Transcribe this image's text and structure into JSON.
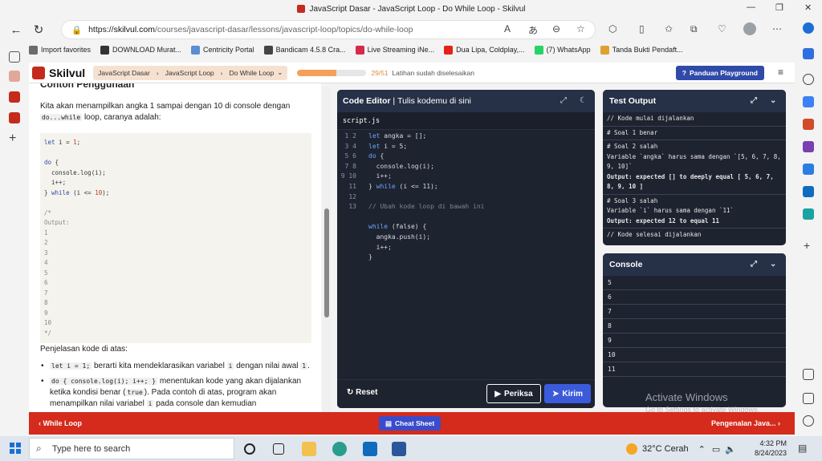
{
  "window": {
    "title": "JavaScript Dasar - JavaScript Loop - Do While Loop - Skilvul"
  },
  "browser": {
    "url_prefix": "https://",
    "url_host": "skilvul.com",
    "url_path": "/courses/javascript-dasar/lessons/javascript-loop/topics/do-while-loop",
    "bookmarks": [
      {
        "label": "Import favorites",
        "color": "#6b6b6b"
      },
      {
        "label": "DOWNLOAD Murat...",
        "color": "#333333"
      },
      {
        "label": "Centricity Portal",
        "color": "#5b8dd6"
      },
      {
        "label": "Bandicam 4.5.8 Cra...",
        "color": "#444444"
      },
      {
        "label": "Live Streaming iNe...",
        "color": "#d62a4a"
      },
      {
        "label": "Dua Lipa, Coldplay,...",
        "color": "#e62117"
      },
      {
        "label": "(7) WhatsApp",
        "color": "#25d366"
      },
      {
        "label": "Tanda Bukti Pendaft...",
        "color": "#e0a030"
      }
    ]
  },
  "header": {
    "logo": "Skilvul",
    "crumbs": [
      "JavaScript Dasar",
      "JavaScript Loop",
      "Do While Loop"
    ],
    "progress_fraction": 0.5686,
    "progress_count": "29/51",
    "progress_label": "Latihan sudah diselesaikan",
    "panduan": "Panduan Playground"
  },
  "lesson": {
    "heading": "Contoh Penggunaan",
    "intro_a": "Kita akan menampilkan angka 1 sampai dengan 10 di console dengan",
    "intro_code": "do...while",
    "intro_b": " loop, caranya adalah:",
    "explain": "Penjelasan kode di atas:",
    "bullet1_code": "let i = 1;",
    "bullet1_text": " berarti kita mendeklarasikan variabel ",
    "bullet1_var": "i",
    "bullet1_tail": " dengan nilai awal ",
    "bullet1_val": "1",
    "bullet1_end": ".",
    "bullet2_code": "do { console.log(i); i++; }",
    "bullet2_text": " menentukan kode yang akan dijalankan ketika kondisi benar (",
    "bullet2_true": "true",
    "bullet2_text2": "). Pada contoh di atas, program akan menampilkan nilai variabel ",
    "bullet2_var": "i",
    "bullet2_tail": " pada console dan kemudian"
  },
  "editor": {
    "title": "Code Editor",
    "subtitle": "Tulis kodemu di sini",
    "filename": "script.js",
    "line_numbers": "1\n2\n3\n4\n5\n6\n7\n8\n9\n10\n11\n12\n13",
    "reset": "Reset",
    "periksa": "Periksa",
    "kirim": "Kirim"
  },
  "test_output": {
    "title": "Test Output",
    "start": "// Kode mulai dijalankan",
    "soal1": "# Soal 1 benar",
    "soal2_head": "# Soal 2 salah",
    "soal2_msg": "Variable `angka` harus sama dengan `[5, 6, 7, 8, 9, 10]`",
    "soal2_out": "Output: expected [] to deeply equal [ 5, 6, 7, 8, 9, 10 ]",
    "soal3_head": "# Soal 3 salah",
    "soal3_msg": "Variable `i` harus sama dengan `11`",
    "soal3_out": "Output: expected 12 to equal 11",
    "end": "// Kode selesai dijalankan"
  },
  "console": {
    "title": "Console",
    "lines": [
      "5",
      "6",
      "7",
      "8",
      "9",
      "10",
      "11"
    ]
  },
  "watermark": {
    "line1": "Activate Windows",
    "line2": "Go to Settings to activate Windows."
  },
  "bottom_nav": {
    "prev": "While Loop",
    "cheat": "Cheat Sheet",
    "next": "Pengenalan Java..."
  },
  "taskbar": {
    "search_placeholder": "Type here to search",
    "weather": "32°C  Cerah",
    "time": "4:32 PM",
    "date": "8/24/2023"
  }
}
